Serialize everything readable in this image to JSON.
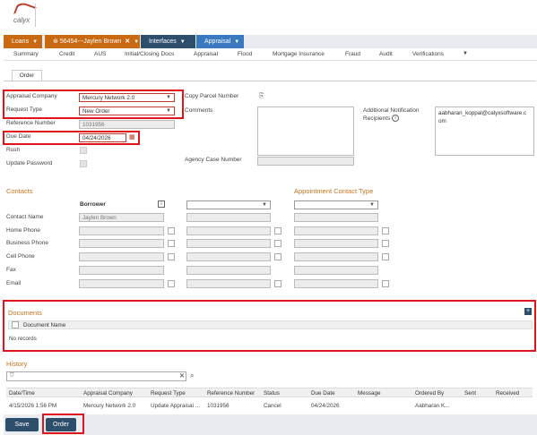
{
  "brand": {
    "logo_text": "calyx"
  },
  "nav": {
    "loans": "Loans",
    "loan": "56454---Jaylen Brown",
    "interfaces": "Interfaces",
    "appraisal": "Appraisal"
  },
  "subnav": [
    "Summary",
    "Credit",
    "AUS",
    "Initial/Closing Docs",
    "Appraisal",
    "Flood",
    "Mortgage Insurance",
    "Fraud",
    "Audit",
    "Verifications"
  ],
  "order_tab": "Order",
  "form": {
    "appraisal_company_label": "Appraisal Company",
    "appraisal_company_value": "Mercury Network 2.0",
    "request_type_label": "Request Type",
    "request_type_value": "New Order",
    "reference_number_label": "Reference Number",
    "reference_number_value": "1031956",
    "due_date_label": "Due Date",
    "due_date_value": "04/24/2026",
    "rush_label": "Rush",
    "update_password_label": "Update Password",
    "copy_parcel_label": "Copy Parcel Number",
    "comments_label": "Comments",
    "agency_case_label": "Agency Case Number",
    "additional_notification_label_1": "Additional Notification",
    "additional_notification_label_2": "Recipients",
    "additional_notification_value_1": "aabharan_koppal@calyxsoftware.c",
    "additional_notification_value_2": "om"
  },
  "contacts": {
    "title": "Contacts",
    "appointment_title": "Appointment Contact Type",
    "borrower_label": "Borrower",
    "rows": [
      "Contact Name",
      "Home Phone",
      "Business Phone",
      "Cell Phone",
      "Fax",
      "Email"
    ],
    "contact_name_value": "Jaylen Brown"
  },
  "documents": {
    "title": "Documents",
    "col_name": "Document Name",
    "empty": "No records"
  },
  "history": {
    "title": "History",
    "search_value": "",
    "columns": [
      "Date/Time",
      "Appraisal Company",
      "Request Type",
      "Reference Number",
      "Status",
      "Due Date",
      "Message",
      "Ordered By",
      "Sent",
      "Received"
    ],
    "row": [
      "4/15/2026 1:56 PM",
      "Mercury Network 2.0",
      "Update Appraisal ...",
      "1031956",
      "Cancel",
      "04/24/2026",
      "",
      "Aabharan K...",
      "",
      ""
    ]
  },
  "buttons": {
    "save": "Save",
    "order": "Order"
  },
  "colors": {
    "accent_orange": "#c96a12",
    "nav_dark": "#2e4f6c",
    "nav_blue": "#3a79c0",
    "highlight_red": "#e0141b"
  }
}
